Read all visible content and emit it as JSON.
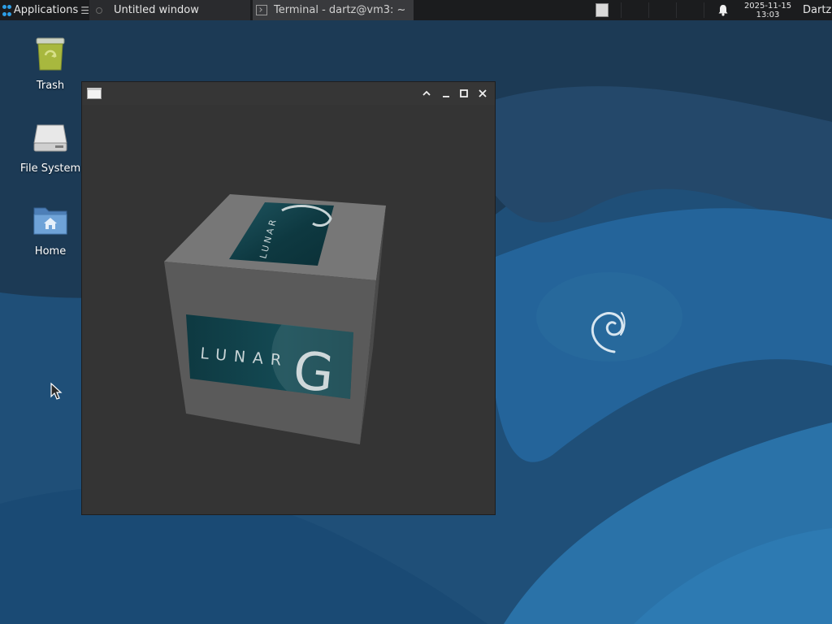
{
  "panel": {
    "applications_label": "Applications",
    "menu_glyph": "☰",
    "tasks": [
      {
        "title": "Untitled window",
        "state": "focused"
      },
      {
        "title": "Terminal - dartz@vm3: ~",
        "state": "normal"
      }
    ],
    "clock": {
      "date": "2025-11-15",
      "time": "13:03"
    },
    "user": "Dartz"
  },
  "desktop": {
    "icons": [
      {
        "label": "Trash",
        "icon": "trash-icon"
      },
      {
        "label": "File System",
        "icon": "drive-icon"
      },
      {
        "label": "Home",
        "icon": "home-folder-icon"
      }
    ]
  },
  "window": {
    "title": "",
    "buttons": [
      "shade",
      "minimize",
      "maximize",
      "close"
    ],
    "cube_logo_text": "LUNAR",
    "cube_logo_letter": "G"
  },
  "colors": {
    "panel_bg": "#1b1c1e",
    "wallpaper_dark": "#1c3a55",
    "wallpaper_light": "#25669a",
    "window_bg": "#343434",
    "accent": "#2d9ee6"
  }
}
